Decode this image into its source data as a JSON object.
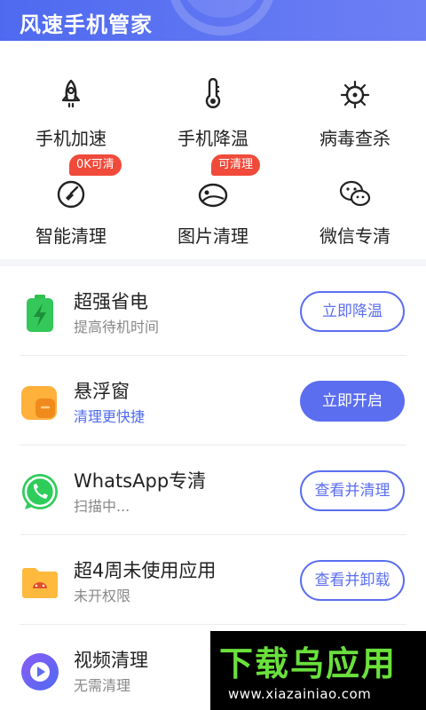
{
  "header": {
    "title": "风速手机管家"
  },
  "tools": [
    {
      "label": "手机加速",
      "icon": "rocket-icon"
    },
    {
      "label": "手机降温",
      "icon": "thermometer-icon"
    },
    {
      "label": "病毒查杀",
      "icon": "virus-icon"
    },
    {
      "label": "智能清理",
      "icon": "broom-icon",
      "badge": "0K可清"
    },
    {
      "label": "图片清理",
      "icon": "image-icon",
      "badge": "可清理"
    },
    {
      "label": "微信专清",
      "icon": "wechat-icon"
    }
  ],
  "list": [
    {
      "title": "超强省电",
      "subtitle": "提高待机时间",
      "button": "立即降温",
      "icon": "battery-icon"
    },
    {
      "title": "悬浮窗",
      "subtitle": "清理更快捷",
      "button": "立即开启",
      "icon": "floating-window-icon"
    },
    {
      "title": "WhatsApp专清",
      "subtitle": "扫描中...",
      "button": "查看并清理",
      "icon": "whatsapp-icon"
    },
    {
      "title": "超4周未使用应用",
      "subtitle": "未开权限",
      "button": "查看并卸载",
      "icon": "android-folder-icon"
    },
    {
      "title": "视频清理",
      "subtitle": "无需清理",
      "icon": "video-icon"
    }
  ],
  "watermark": {
    "main": "下载乌应用",
    "url": "www.xiazainiao.com"
  },
  "colors": {
    "primary": "#5b6ef0",
    "badge": "#f04a3a",
    "watermark_green": "#6be03c"
  }
}
